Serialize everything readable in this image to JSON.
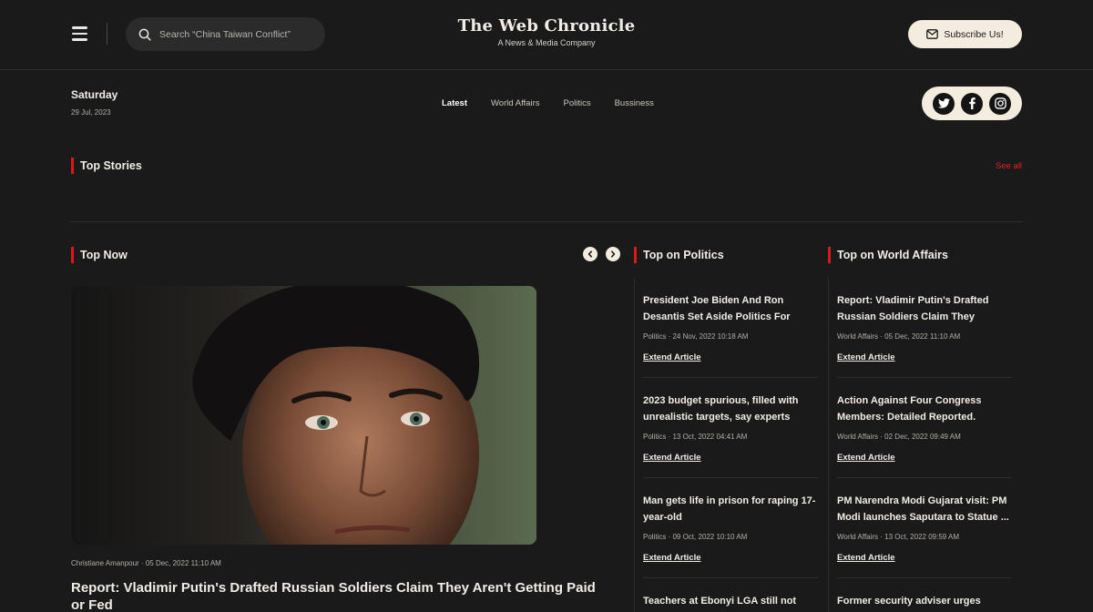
{
  "header": {
    "search_placeholder": "Search “China Taiwan Conflict”",
    "brand_title": "The Web Chronicle",
    "brand_subtitle": "A News & Media Company",
    "subscribe_label": "Subscribe Us!"
  },
  "date": {
    "day": "Saturday",
    "full": "29 Jul, 2023"
  },
  "nav": [
    "Latest",
    "World Affairs",
    "Politics",
    "Bussiness"
  ],
  "top_stories": {
    "title": "Top Stories",
    "see_all": "See all"
  },
  "top_now": {
    "title": "Top Now",
    "meta": "Christiane Amanpour  ·  05 Dec, 2022 11:10 AM",
    "headline": "Report: Vladimir Putin's Drafted Russian Soldiers Claim They Aren't Getting Paid or Fed"
  },
  "politics": {
    "title": "Top on Politics",
    "articles": [
      {
        "title": "President Joe Biden And Ron Desantis Set Aside Politics For The...",
        "meta": "Politics  ·  24 Nov, 2022 10:18 AM",
        "link": "Extend Article"
      },
      {
        "title": "2023 budget spurious, filled with unrealistic targets, say experts",
        "meta": "Politics  ·  13 Oct, 2022 04:41 AM",
        "link": "Extend Article"
      },
      {
        "title": "Man gets life in prison for raping 17-year-old",
        "meta": "Politics  ·  09 Oct, 2022 10:10 AM",
        "link": "Extend Article"
      },
      {
        "title": "Teachers at Ebonyi LGA still not",
        "meta": "",
        "link": ""
      }
    ]
  },
  "world": {
    "title": "Top on World Affairs",
    "articles": [
      {
        "title": "Report: Vladimir Putin's Drafted Russian Soldiers Claim They Aren't...",
        "meta": "World Affairs  ·  05 Dec, 2022 11:10 AM",
        "link": "Extend Article"
      },
      {
        "title": "Action Against Four Congress Members: Detailed Reported.",
        "meta": "World Affairs  ·  02 Dec, 2022 09:49 AM",
        "link": "Extend Article"
      },
      {
        "title": "PM Narendra Modi Gujarat visit: PM Modi launches Saputara to Statue ...",
        "meta": "World Affairs  ·  13 Oct, 2022 09:59 AM",
        "link": "Extend Article"
      },
      {
        "title": "Former security adviser urges Buhari",
        "meta": "",
        "link": ""
      }
    ]
  },
  "icons": {
    "menu": "hamburger-menu-icon",
    "search": "search-icon",
    "mail": "mail-icon",
    "social": [
      "twitter-icon",
      "facebook-icon",
      "instagram-icon"
    ],
    "arrows": [
      "chevron-left-icon",
      "chevron-right-icon"
    ]
  },
  "colors": {
    "background": "#1b1a1a",
    "accent": "#d91a1a",
    "cream": "#f4ecdf",
    "text": "#ece8e1"
  }
}
